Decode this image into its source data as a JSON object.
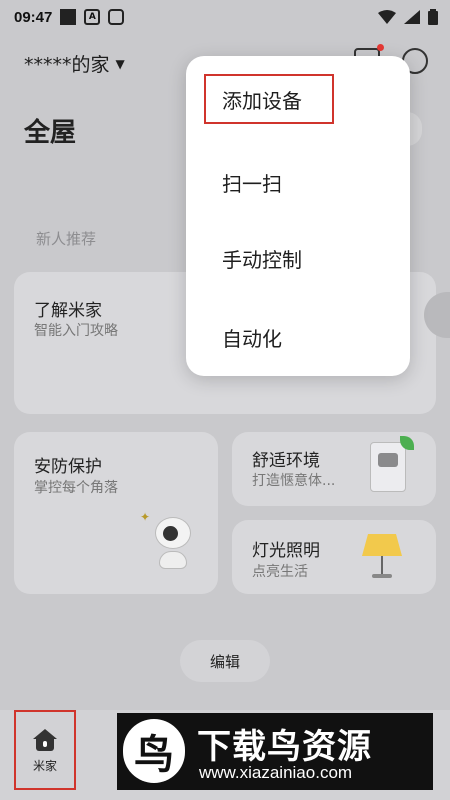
{
  "status_bar": {
    "time": "09:47",
    "icons": [
      "square-icon",
      "a-icon",
      "location-icon",
      "wifi-icon",
      "signal-icon",
      "battery-icon"
    ]
  },
  "header": {
    "home_name": "*****的家",
    "page_title": "全屋"
  },
  "section_label": "新人推荐",
  "cards": {
    "intro": {
      "title": "了解米家",
      "subtitle": "智能入门攻略"
    },
    "security": {
      "title": "安防保护",
      "subtitle": "掌控每个角落"
    },
    "comfort": {
      "title": "舒适环境",
      "subtitle": "打造惬意体..."
    },
    "lighting": {
      "title": "灯光照明",
      "subtitle": "点亮生活"
    }
  },
  "edit_button": "编辑",
  "menu": {
    "items": [
      "添加设备",
      "扫一扫",
      "手动控制",
      "自动化"
    ]
  },
  "bottom_nav": {
    "home_label": "米家"
  },
  "watermark": {
    "logo_char": "鸟",
    "title": "下载鸟资源",
    "url": "www.xiazainiao.com"
  },
  "colors": {
    "highlight_box": "#d0342c",
    "notification_dot": "#e53935"
  }
}
